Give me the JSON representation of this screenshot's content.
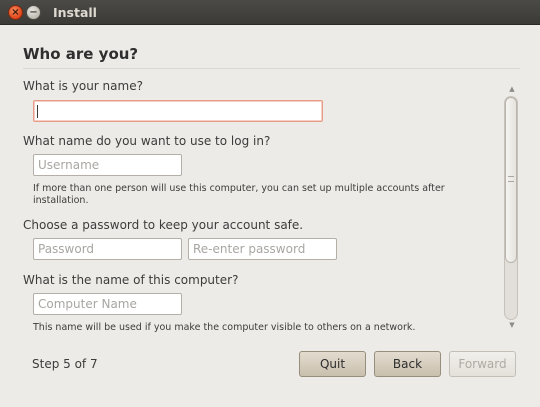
{
  "window": {
    "title": "Install",
    "close_glyph": "×",
    "minimize_glyph": "−"
  },
  "page": {
    "heading": "Who are you?"
  },
  "form": {
    "name_label": "What is your name?",
    "name_value": "",
    "login_label": "What name do you want to use to log in?",
    "username_placeholder": "Username",
    "login_note": "If more than one person will use this computer, you can set up multiple accounts after installation.",
    "password_label": "Choose a password to keep your account safe.",
    "password_placeholder": "Password",
    "reenter_placeholder": "Re-enter password",
    "computer_label": "What is the name of this computer?",
    "computer_placeholder": "Computer Name",
    "computer_note": "This name will be used if you make the computer visible to others on a network."
  },
  "scrollbar": {
    "up_glyph": "▲",
    "down_glyph": "▼"
  },
  "footer": {
    "step": "Step 5 of 7",
    "quit": "Quit",
    "back": "Back",
    "forward": "Forward"
  },
  "colors": {
    "titlebar": "#3c3b37",
    "close_button": "#e1441a",
    "focus_border": "#e79b86",
    "button": "#d6cebf"
  }
}
